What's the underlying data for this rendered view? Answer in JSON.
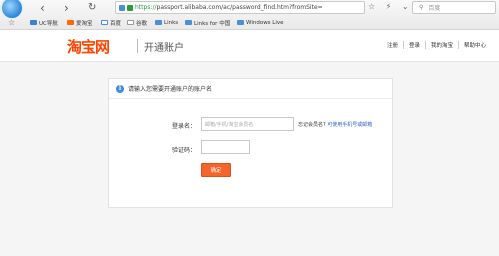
{
  "browser": {
    "nav": {
      "back": "‹",
      "forward": "›",
      "reload": "↻"
    },
    "url": {
      "scheme": "https://",
      "rest": "passport.alibaba.com/ac/password_find.htm?fromSite="
    },
    "tools": "☆ ⚡ ⌄",
    "search_placeholder": "百度",
    "bookmarks": [
      {
        "label": "UC导航"
      },
      {
        "label": "爱淘宝"
      },
      {
        "label": "百度"
      },
      {
        "label": "谷歌"
      },
      {
        "label": "Links"
      },
      {
        "label": "Links for 中国"
      },
      {
        "label": "Windows Live"
      }
    ]
  },
  "header": {
    "logo": "淘宝网",
    "title": "开通账户",
    "links": [
      "注册",
      "登录",
      "我的淘宝",
      "帮助中心"
    ]
  },
  "panel": {
    "notice": "请输入您需要开通账户的账户名",
    "account_label": "登录名：",
    "account_placeholder": "邮箱/手机/淘宝会员名",
    "hint_prefix": "忘记会员名?",
    "hint_link": "可使用手机号或邮箱",
    "captcha_label": "验证码：",
    "captcha_value": "",
    "confirm": "确定"
  },
  "colors": {
    "brand": "#ff4400",
    "button": "#f5642a",
    "info": "#3d8de0"
  }
}
